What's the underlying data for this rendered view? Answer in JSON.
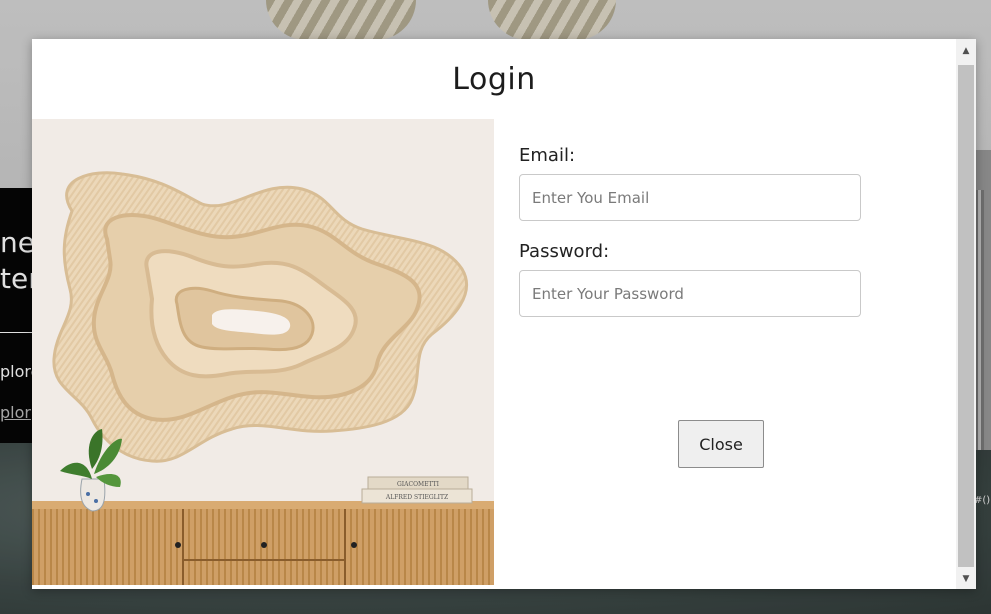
{
  "background": {
    "hero_line1": "ne",
    "hero_line2": "ter",
    "hero_small": "plore",
    "hero_link": "plor",
    "right_label": "#()"
  },
  "modal": {
    "title": "Login",
    "email_label": "Email:",
    "email_placeholder": "Enter You Email",
    "email_value": "",
    "password_label": "Password:",
    "password_placeholder": "Enter Your Password",
    "password_value": "",
    "close_label": "Close",
    "image": {
      "book_top": "GIACOMETTI",
      "book_bottom": "ALFRED STIEGLITZ"
    }
  },
  "scrollbar": {
    "up_icon": "triangle-up-icon",
    "down_icon": "triangle-down-icon"
  },
  "colors": {
    "modal_bg": "#ffffff",
    "hero_bg": "#060606",
    "wood": "#c99a62",
    "weave": "#e9d3b4"
  }
}
